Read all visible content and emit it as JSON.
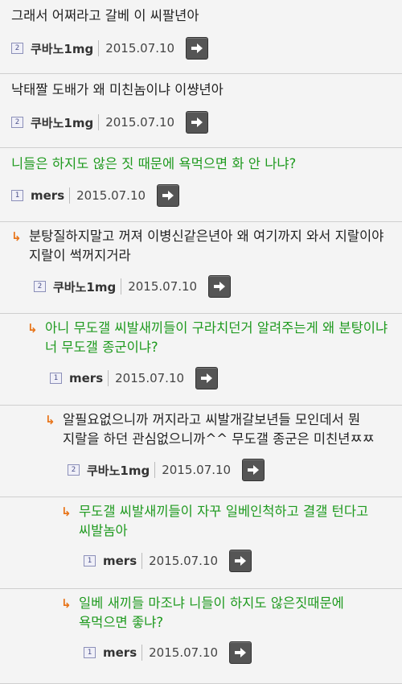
{
  "comments": [
    {
      "indent": 0,
      "reply": false,
      "green": false,
      "text": "그래서 어쩌라고 갈베 이 씨팔년아",
      "level": "2",
      "author": "쿠바노1mg",
      "date": "2015.07.10"
    },
    {
      "indent": 0,
      "reply": false,
      "green": false,
      "text": "낙태짤 도배가 왜 미친놈이냐 이썅년아",
      "level": "2",
      "author": "쿠바노1mg",
      "date": "2015.07.10"
    },
    {
      "indent": 0,
      "reply": false,
      "green": true,
      "text": "니들은 하지도 않은 짓 때문에 욕먹으면 화 안 나냐?",
      "level": "1",
      "author": "mers",
      "date": "2015.07.10"
    },
    {
      "indent": 1,
      "reply": true,
      "green": false,
      "text": "분탕질하지말고 꺼져 이병신같은년아 왜 여기까지 와서 지랄이야 지랄이 썩꺼지거라",
      "level": "2",
      "author": "쿠바노1mg",
      "date": "2015.07.10"
    },
    {
      "indent": 2,
      "reply": true,
      "green": true,
      "text": "아니 무도갤 씨발새끼들이 구라치던거 알려주는게 왜 분탕이냐 너 무도갤 종군이냐?",
      "level": "1",
      "author": "mers",
      "date": "2015.07.10"
    },
    {
      "indent": 3,
      "reply": true,
      "green": false,
      "text": "알필요없으니까 꺼지라고 씨발개갈보년들 모인데서 뭔 지랄을 하던 관심없으니까^^ 무도갤 종군은 미친년ㅉㅉ",
      "level": "2",
      "author": "쿠바노1mg",
      "date": "2015.07.10"
    },
    {
      "indent": 4,
      "reply": true,
      "green": true,
      "text": "무도갤 씨발새끼들이 자꾸 일베인척하고 결갤 턴다고 씨발놈아",
      "level": "1",
      "author": "mers",
      "date": "2015.07.10"
    },
    {
      "indent": 4,
      "reply": true,
      "green": true,
      "text": "일베 새끼들 마조냐 니들이 하지도 않은짓때문에 욕먹으면 좋냐?",
      "level": "1",
      "author": "mers",
      "date": "2015.07.10"
    }
  ],
  "icons": {
    "reply": "reply-arrow-icon",
    "go": "arrow-right-icon",
    "level": "level-badge-icon"
  },
  "colors": {
    "green_text": "#1f9a1f",
    "reply_arrow": "#e8751a",
    "button": "#555555",
    "background": "#f4f4f4"
  }
}
